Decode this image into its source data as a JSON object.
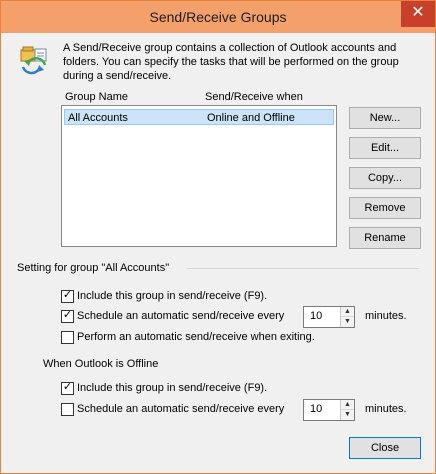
{
  "window": {
    "title": "Send/Receive Groups"
  },
  "description": "A Send/Receive group contains a collection of Outlook accounts and folders. You can specify the tasks that will be performed on the group during a send/receive.",
  "list": {
    "columns": [
      "Group Name",
      "Send/Receive when"
    ],
    "rows": [
      {
        "name": "All Accounts",
        "when": "Online and Offline",
        "selected": true
      }
    ]
  },
  "buttons": {
    "new": "New...",
    "edit": "Edit...",
    "copy": "Copy...",
    "remove": "Remove",
    "rename": "Rename",
    "close": "Close"
  },
  "online": {
    "heading": "Setting for group \"All Accounts\"",
    "include_label": "Include this group in send/receive (F9).",
    "include_checked": true,
    "schedule_label": "Schedule an automatic send/receive every",
    "schedule_checked": true,
    "schedule_value": "10",
    "schedule_unit": "minutes.",
    "exit_label": "Perform an automatic send/receive when exiting.",
    "exit_checked": false
  },
  "offline": {
    "heading": "When Outlook is Offline",
    "include_label": "Include this group in send/receive (F9).",
    "include_checked": true,
    "schedule_label": "Schedule an automatic send/receive every",
    "schedule_checked": false,
    "schedule_value": "10",
    "schedule_unit": "minutes."
  },
  "icons": {
    "close": "close-icon",
    "send_receive": "send-receive-groups-icon",
    "check": "check-icon",
    "spin_up": "spin-up-icon",
    "spin_down": "spin-down-icon"
  },
  "colors": {
    "titlebar": "#f4a06a",
    "close_button": "#c9402a",
    "selection": "#cce4f7",
    "default_button_border": "#0078d7"
  }
}
